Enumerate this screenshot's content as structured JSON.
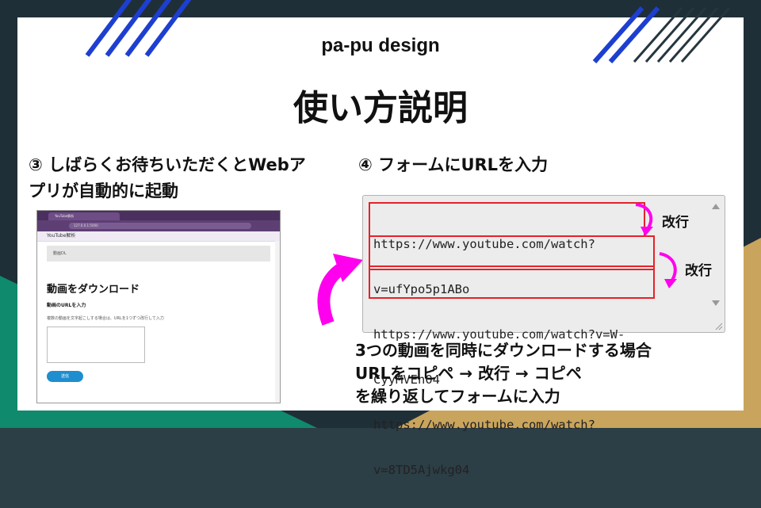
{
  "brand": "pa-pu design",
  "title": "使い方説明",
  "step3": {
    "line1": "③ しばらくお待ちいただくとWebア",
    "line2": "プリが自動的に起動"
  },
  "step4": {
    "label": "④ フォームにURLを入力"
  },
  "screenshot": {
    "tab_title": "YouTube解析",
    "address": "127.0.0.1:5000",
    "app_name": "YouTube解析",
    "subnav": "動画DL",
    "heading": "動画をダウンロード",
    "input_label": "動画のURLを入力",
    "input_help": "複数の動画を文字起こしする場合は、URLを1つずつ改行して入力",
    "submit_label": "送信"
  },
  "form": {
    "urls": [
      "https://www.youtube.com/watch?",
      "v=ufYpo5p1ABo",
      "https://www.youtube.com/watch?v=W-",
      "CyyMVEn04",
      "https://www.youtube.com/watch?",
      "v=8TD5Ajwkg04"
    ]
  },
  "annotations": {
    "newline_1": "改行",
    "newline_2": "改行"
  },
  "note": {
    "line1": "3つの動画を同時にダウンロードする場合",
    "line2": "URLをコピペ → 改行 → コピペ",
    "line3": "を繰り返してフォームに入力"
  },
  "colors": {
    "accent_red": "#e5222a",
    "arrow_magenta": "#ff00ee",
    "stripe_blue": "#1d3fd1"
  }
}
